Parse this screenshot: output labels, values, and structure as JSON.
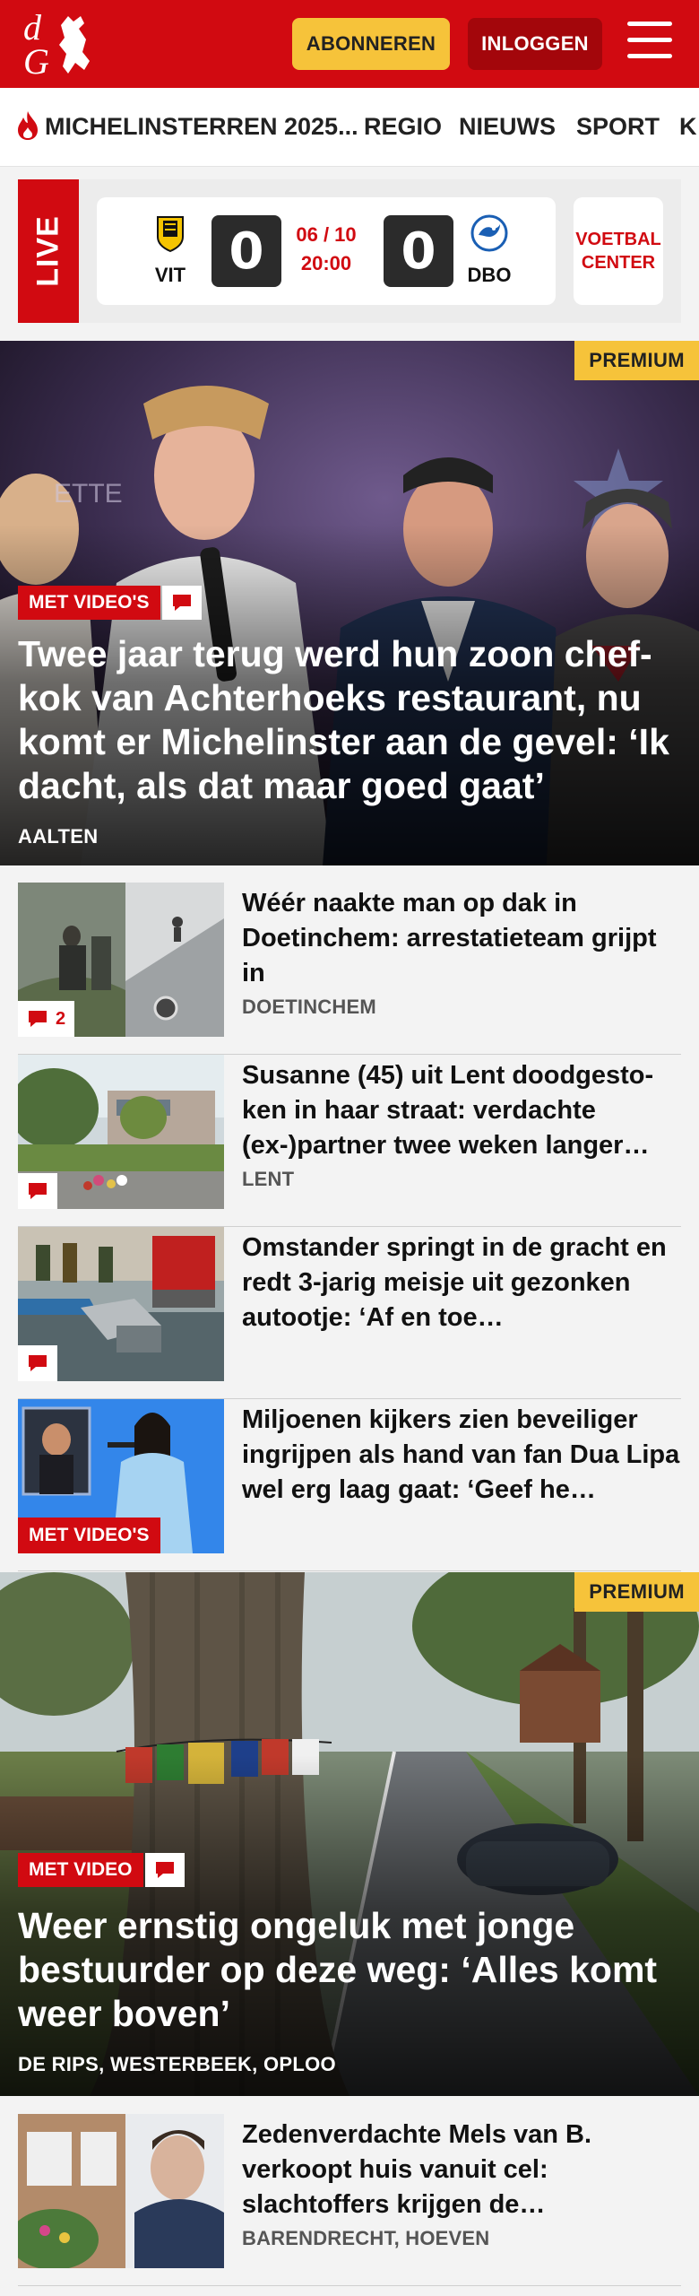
{
  "header": {
    "logo_text": "dG",
    "subscribe_label": "ABONNEREN",
    "login_label": "INLOGGEN"
  },
  "nav": {
    "items": [
      "MICHELINSTERREN 2025...",
      "REGIO",
      "NIEUWS",
      "SPORT",
      "K"
    ]
  },
  "live": {
    "label": "LIVE",
    "home_team": "VIT",
    "away_team": "DBO",
    "home_score": "0",
    "away_score": "0",
    "date": "06 / 10",
    "time": "20:00",
    "voetbal_center": "VOETBAL CENTER"
  },
  "hero1": {
    "premium": "PREMIUM",
    "video_label": "MET VIDEO'S",
    "title": "Twee jaar terug werd hun zoon chef-kok van Achterhoeks restaurant, nu komt er Michelinster aan de gevel: ‘Ik dacht, als dat maar goed gaat’",
    "location": "AALTEN"
  },
  "list1": [
    {
      "title": "Wéér naakte man op dak in Doetinchem: arrestatieteam grijpt in",
      "location": "DOETINCHEM",
      "comments": "2"
    },
    {
      "title": "Susanne (45) uit Lent doodgesto-ken in haar straat: verdachte (ex-)partner twee weken langer…",
      "location": "LENT"
    },
    {
      "title": "Omstander springt in de gracht en redt 3-jarig meisje uit gezonken autootje: ‘Af en toe…",
      "location": ""
    },
    {
      "title": "Miljoenen kijkers zien beveiliger ingrijpen als hand van fan Dua Lipa wel erg laag gaat: ‘Geef he…",
      "location": "",
      "video_label": "MET VIDEO'S"
    }
  ],
  "hero2": {
    "premium": "PREMIUM",
    "video_label": "MET VIDEO",
    "title": "Weer ernstig ongeluk met jonge bestuurder op deze weg: ‘Alles komt weer boven’",
    "location": "DE RIPS, WESTERBEEK, OPLOO"
  },
  "list2": [
    {
      "title": "Zedenverdachte Mels van B. verkoopt huis vanuit cel: slachtoffers krijgen de…",
      "location": "BARENDRECHT, HOEVEN"
    }
  ],
  "colors": {
    "brand_red": "#d10a11",
    "premium_yellow": "#f6c33a"
  }
}
